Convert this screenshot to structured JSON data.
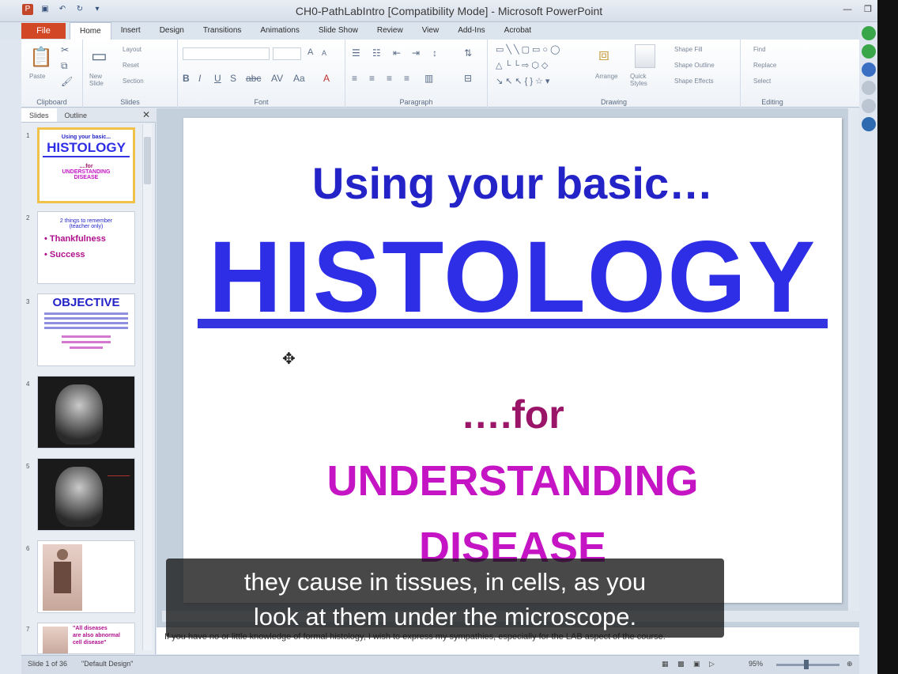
{
  "window": {
    "title": "CH0-PathLabIntro [Compatibility Mode] - Microsoft PowerPoint"
  },
  "ribbon": {
    "file_tab": "File",
    "tabs": [
      "Home",
      "Insert",
      "Design",
      "Transitions",
      "Animations",
      "Slide Show",
      "Review",
      "View",
      "Add-Ins",
      "Acrobat"
    ],
    "groups": [
      "Clipboard",
      "Slides",
      "Font",
      "Paragraph",
      "Drawing",
      "Editing"
    ],
    "buttons": {
      "paste": "Paste",
      "new_slide": "New Slide",
      "layout": "Layout",
      "reset": "Reset",
      "section": "Section",
      "arrange": "Arrange",
      "quick_styles": "Quick Styles",
      "shape_fill": "Shape Fill",
      "shape_outline": "Shape Outline",
      "shape_effects": "Shape Effects",
      "find": "Find",
      "replace": "Replace",
      "select": "Select"
    }
  },
  "panel": {
    "tabs": [
      "Slides",
      "Outline"
    ],
    "thumbnails": [
      {
        "num": "1",
        "lines": [
          "Using your basic...",
          "HISTOLOGY",
          "....for",
          "UNDERSTANDING",
          "DISEASE"
        ]
      },
      {
        "num": "2",
        "lines": [
          "2 things to remember",
          "(teacher only)",
          "• Thankfulness",
          "• Success"
        ]
      },
      {
        "num": "3",
        "lines": [
          "OBJECTIVE"
        ]
      },
      {
        "num": "4",
        "lines": []
      },
      {
        "num": "5",
        "lines": []
      },
      {
        "num": "6",
        "lines": []
      },
      {
        "num": "7",
        "lines": [
          "\"All diseases",
          "are also abnormal",
          "cell disease\""
        ]
      }
    ]
  },
  "slide": {
    "line1": "Using your basic…",
    "title": "HISTOLOGY",
    "line2": "….for",
    "line3": "UNDERSTANDING",
    "line4": "DISEASE"
  },
  "notes": {
    "text": "If you have no or little knowledge of formal histology, I wish to express my sympathies, especially for the LAB aspect of the course."
  },
  "status": {
    "slide_count": "Slide 1 of 36",
    "theme": "\"Default Design\"",
    "zoom": "95%"
  },
  "caption": {
    "line1": "they cause in tissues, in cells, as you",
    "line2": "look at them under the microscope."
  }
}
